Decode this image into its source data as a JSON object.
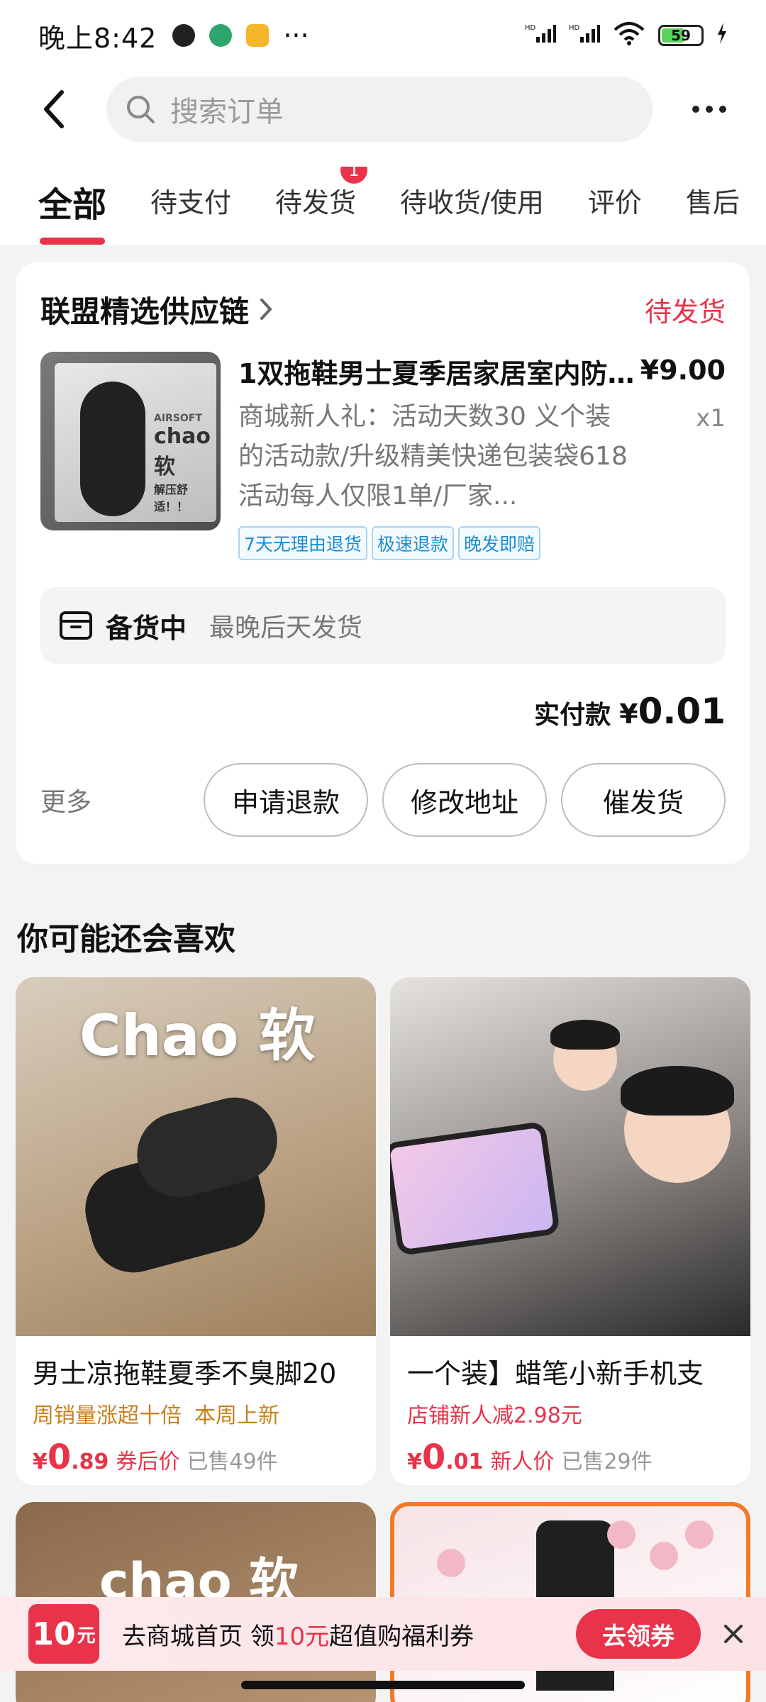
{
  "status_bar": {
    "time": "晚上8:42",
    "more": "···",
    "network_1": "HD",
    "network_2": "HD",
    "battery": "59"
  },
  "search": {
    "placeholder": "搜索订单"
  },
  "tabs": [
    {
      "label": "全部",
      "active": true
    },
    {
      "label": "待支付"
    },
    {
      "label": "待发货",
      "badge": "1"
    },
    {
      "label": "待收货/使用"
    },
    {
      "label": "评价"
    },
    {
      "label": "售后"
    }
  ],
  "order": {
    "store": "联盟精选供应链",
    "status": "待发货",
    "product_title": "1双拖鞋男士夏季居家居室内防滑...",
    "product_desc": "商城新人礼：活动天数30 义个装的活动款/升级精美快递包装袋618活动每人仅限1单/厂家...",
    "price": "¥9.00",
    "qty": "x1",
    "image_text": {
      "brand": "AIRSOFT",
      "title": "chao软",
      "sub": "解压舒适！！"
    },
    "tags": [
      "7天无理由退货",
      "极速退款",
      "晚发即赔"
    ],
    "shipping": {
      "title": "备货中",
      "sub": "最晚后天发货"
    },
    "paid_label": "实付款",
    "paid_amount_symbol": "¥",
    "paid_amount_int": "0",
    "paid_amount_dec": ".01",
    "more_label": "更多",
    "actions": [
      "申请退款",
      "修改地址",
      "催发货"
    ]
  },
  "recommend": {
    "title": "你可能还会喜欢",
    "items": [
      {
        "image_text": "Chao 软",
        "name": "男士凉拖鞋夏季不臭脚20",
        "tags": [
          "周销量涨超十倍",
          "本周上新"
        ],
        "price_symbol": "¥",
        "price_int": "0",
        "price_dec": ".89",
        "price_label": "券后价",
        "sold": "已售49件"
      },
      {
        "name": "一个装】蜡笔小新手机支",
        "tags": [
          "店铺新人减2.98元"
        ],
        "price_symbol": "¥",
        "price_int": "0",
        "price_dec": ".01",
        "price_label": "新人价",
        "sold": "已售29件"
      },
      {
        "image_text": "chao 软"
      },
      {}
    ]
  },
  "promo": {
    "coupon_amount": "10",
    "coupon_unit": "元",
    "text_prefix": "去商城首页 领",
    "text_highlight": "10元",
    "text_suffix": "超值购福利券",
    "button": "去领券"
  },
  "colors": {
    "accent": "#e8334a",
    "tag_blue": "#1b8bd1",
    "tag_orange": "#c8801e"
  }
}
